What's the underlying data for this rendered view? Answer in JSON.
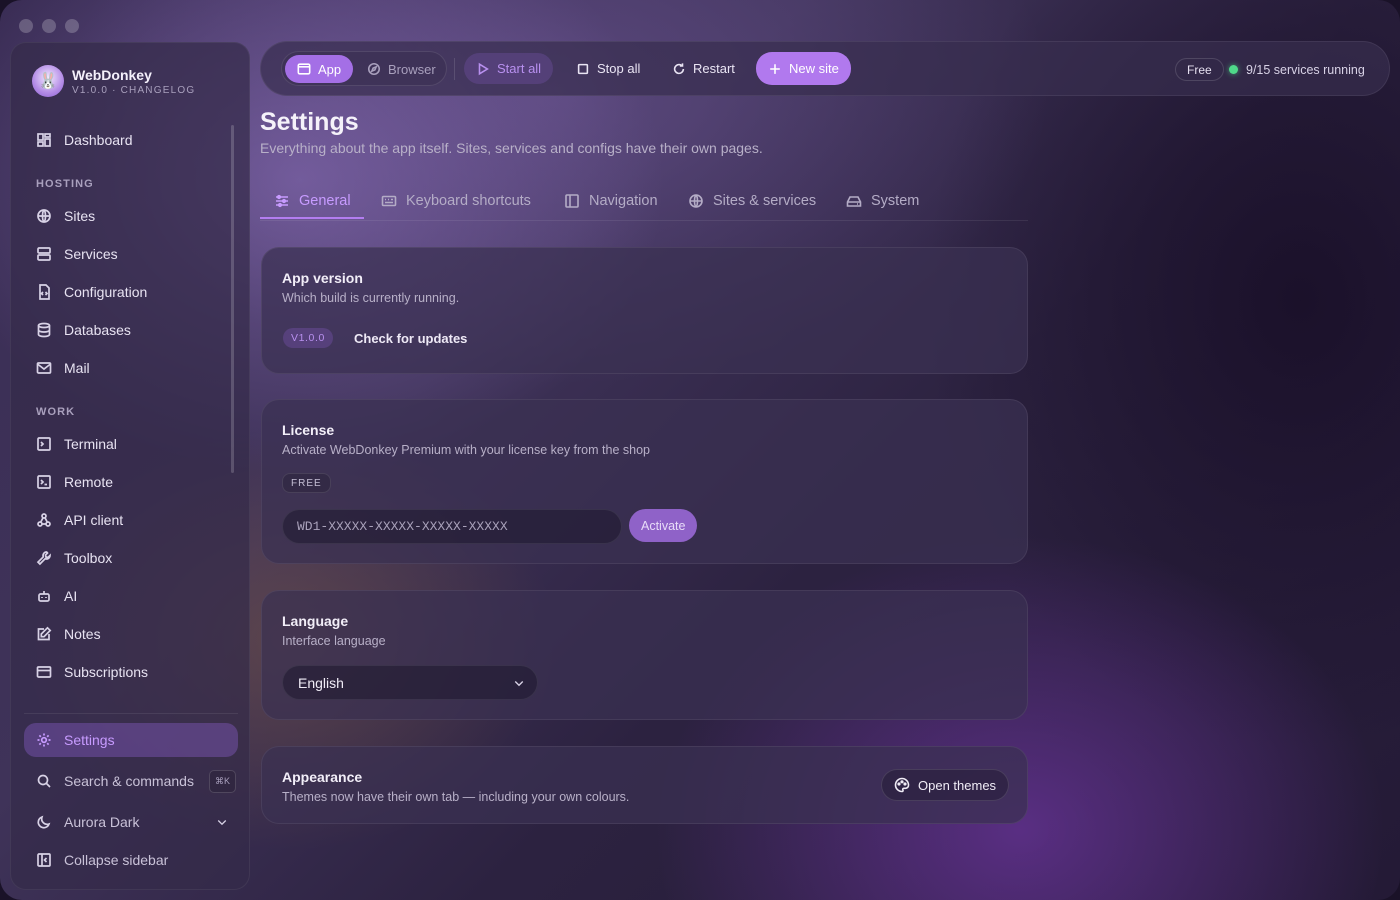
{
  "app": {
    "name": "WebDonkey",
    "subtitle": "V1.0.0 · CHANGELOG"
  },
  "sidebar": {
    "dashboard": "Dashboard",
    "sections": {
      "hosting": "HOSTING",
      "work": "WORK"
    },
    "hosting_items": [
      "Sites",
      "Services",
      "Configuration",
      "Databases",
      "Mail"
    ],
    "work_items": [
      "Terminal",
      "Remote",
      "API client",
      "Toolbox",
      "AI",
      "Notes",
      "Subscriptions"
    ],
    "settings": "Settings",
    "search": "Search & commands",
    "search_shortcut": "⌘K",
    "theme": "Aurora Dark",
    "collapse": "Collapse sidebar"
  },
  "toolbar": {
    "mode_app": "App",
    "mode_browser": "Browser",
    "start_all": "Start all",
    "stop_all": "Stop all",
    "restart": "Restart",
    "new_site": "New site",
    "plan": "Free",
    "services_status": "9/15 services running",
    "status_color": "#4fd98a"
  },
  "page": {
    "title": "Settings",
    "subtitle": "Everything about the app itself. Sites, services and configs have their own pages."
  },
  "tabs": [
    "General",
    "Keyboard shortcuts",
    "Navigation",
    "Sites & services",
    "System"
  ],
  "cards": {
    "version": {
      "title": "App version",
      "desc": "Which build is currently running.",
      "badge": "V1.0.0",
      "action": "Check for updates"
    },
    "license": {
      "title": "License",
      "desc": "Activate WebDonkey Premium with your license key from the shop",
      "badge": "FREE",
      "placeholder": "WD1-XXXXX-XXXXX-XXXXX-XXXXX",
      "button": "Activate"
    },
    "language": {
      "title": "Language",
      "desc": "Interface language",
      "value": "English"
    },
    "appearance": {
      "title": "Appearance",
      "desc": "Themes now have their own tab — including your own colours.",
      "button": "Open themes"
    }
  },
  "colors": {
    "accent": "#b179ee",
    "accent_text": "#c79bff"
  }
}
